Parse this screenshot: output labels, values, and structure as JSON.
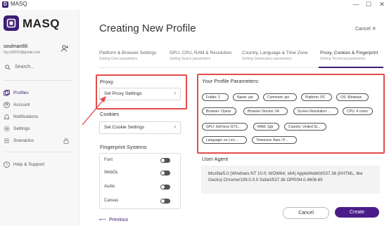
{
  "window": {
    "title": "MASQ",
    "logo_letter": "D"
  },
  "sidebar": {
    "brand": "MASQ",
    "user": {
      "name": "soulman66",
      "email": "hyy138153@gmail.com"
    },
    "search_placeholder": "Search...",
    "items": [
      {
        "label": "Profiles",
        "icon": "profiles-icon",
        "active": true
      },
      {
        "label": "Account",
        "icon": "account-icon"
      },
      {
        "label": "Notifications",
        "icon": "bell-icon"
      },
      {
        "label": "Settings",
        "icon": "gear-icon"
      },
      {
        "label": "Scenarios",
        "icon": "scenarios-icon"
      },
      {
        "label": "Help & Support",
        "icon": "help-icon"
      }
    ]
  },
  "main": {
    "title": "Creating New Profile",
    "cancel": "Cancel",
    "tabs": [
      {
        "label": "Platform & Browser Settings",
        "sub": "Setting Core parameters"
      },
      {
        "label": "GPU, CPU, RAM & Resolution",
        "sub": "Setting Sysics parameters"
      },
      {
        "label": "Country, Language & Time Zone",
        "sub": "Setting Geolocation parameters"
      },
      {
        "label": "Proxy, Cookies & Fingerprint",
        "sub": "Setting Technical parameters"
      }
    ],
    "proxy": {
      "title": "Proxy",
      "button": "Set Proxy Settings"
    },
    "cookies": {
      "title": "Cookies",
      "button": "Set Cookie Settings"
    },
    "fingerprint": {
      "title": "Fingerprint Systems",
      "rows": [
        "Font",
        "WebGL",
        "Audio",
        "Canvas"
      ]
    },
    "previous": "Previous",
    "params": {
      "title": "Your Profile Parameters:",
      "chips": [
        "Folder: 1",
        "Name: pie",
        "Comment: pie",
        "Platform: PC",
        "OS: Windows",
        "Browser: Opera",
        "Browser Version: 94",
        "Screen Resolution: ...",
        "CPU: 4 cores",
        "GPU: GeForce GTX...",
        "RAM: 2gb",
        "Country: United St...",
        "Language: en | en-...",
        "Timezone: Asia / P..."
      ]
    },
    "user_agent": {
      "title": "User Agent",
      "text": "Mozilla/5.0 (Windows NT 10.0; WOW64; x64) AppleWebKit/537.36 (KHTML, like Gecko) Chrome/109.0.0.0 Safari/537.36 OPR/94.0.4606.65"
    },
    "buttons": {
      "cancel": "Cancel",
      "create": "Create"
    }
  },
  "colors": {
    "brand": "#3d1e72",
    "primary_button": "#4a1c8a",
    "annotation": "#e24b4b"
  }
}
